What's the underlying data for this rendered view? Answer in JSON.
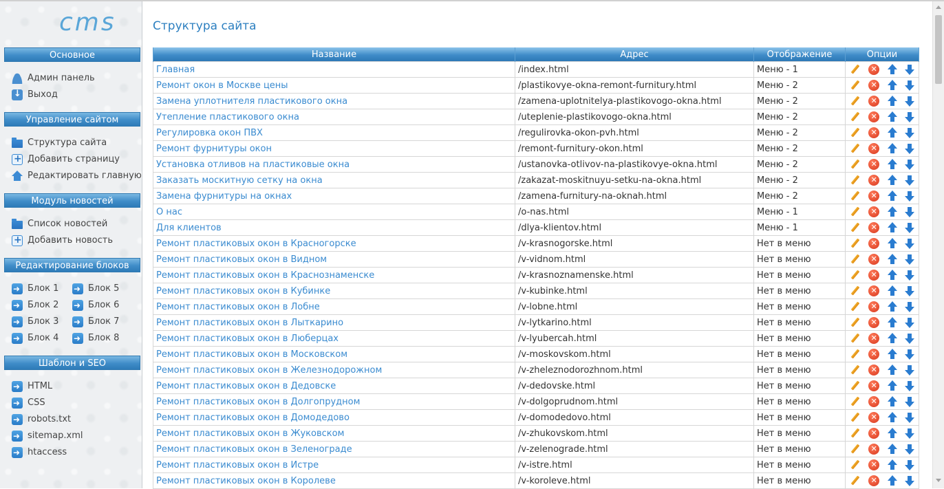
{
  "logo": "cms",
  "sidebar": {
    "sections": [
      {
        "title": "Основное",
        "items": [
          {
            "label": "Админ панель",
            "icon": "user-icon"
          },
          {
            "label": "Выход",
            "icon": "exit-icon"
          }
        ]
      },
      {
        "title": "Управление сайтом",
        "items": [
          {
            "label": "Структура сайта",
            "icon": "folder-icon"
          },
          {
            "label": "Добавить страницу",
            "icon": "add-icon"
          },
          {
            "label": "Редактировать главную",
            "icon": "home-icon"
          }
        ]
      },
      {
        "title": "Модуль новостей",
        "items": [
          {
            "label": "Список новостей",
            "icon": "folder-icon"
          },
          {
            "label": "Добавить новость",
            "icon": "add-icon"
          }
        ]
      },
      {
        "title": "Редактирование блоков",
        "items": [
          {
            "label": "Блок 1",
            "icon": "arrow-right-icon"
          },
          {
            "label": "Блок 5",
            "icon": "arrow-right-icon"
          },
          {
            "label": "Блок 2",
            "icon": "arrow-right-icon"
          },
          {
            "label": "Блок 6",
            "icon": "arrow-right-icon"
          },
          {
            "label": "Блок 3",
            "icon": "arrow-right-icon"
          },
          {
            "label": "Блок 7",
            "icon": "arrow-right-icon"
          },
          {
            "label": "Блок 4",
            "icon": "arrow-right-icon"
          },
          {
            "label": "Блок 8",
            "icon": "arrow-right-icon"
          }
        ]
      },
      {
        "title": "Шаблон и SEO",
        "items": [
          {
            "label": "HTML",
            "icon": "arrow-right-icon"
          },
          {
            "label": "CSS",
            "icon": "arrow-right-icon"
          },
          {
            "label": "robots.txt",
            "icon": "arrow-right-icon"
          },
          {
            "label": "sitemap.xml",
            "icon": "arrow-right-icon"
          },
          {
            "label": "htaccess",
            "icon": "arrow-right-icon"
          }
        ]
      }
    ]
  },
  "main": {
    "title": "Структура сайта",
    "table": {
      "columns": [
        "Название",
        "Адрес",
        "Отображение",
        "Опции"
      ],
      "rows": [
        [
          "Главная",
          "/index.html",
          "Меню - 1"
        ],
        [
          "Ремонт окон в Москве цены",
          "/plastikovye-okna-remont-furnitury.html",
          "Меню - 2"
        ],
        [
          "Замена уплотнителя пластикового окна",
          "/zamena-uplotnitelya-plastikovogo-okna.html",
          "Меню - 2"
        ],
        [
          "Утепление пластикового окна",
          "/uteplenie-plastikovogo-okna.html",
          "Меню - 2"
        ],
        [
          "Регулировка окон ПВХ",
          "/regulirovka-okon-pvh.html",
          "Меню - 2"
        ],
        [
          "Ремонт фурнитуры окон",
          "/remont-furnitury-okon.html",
          "Меню - 2"
        ],
        [
          "Установка отливов на пластиковые окна",
          "/ustanovka-otlivov-na-plastikovye-okna.html",
          "Меню - 2"
        ],
        [
          "Заказать москитную сетку на окна",
          "/zakazat-moskitnuyu-setku-na-okna.html",
          "Меню - 2"
        ],
        [
          "Замена фурнитуры на окнах",
          "/zamena-furnitury-na-oknah.html",
          "Меню - 2"
        ],
        [
          "О нас",
          "/o-nas.html",
          "Меню - 1"
        ],
        [
          "Для клиентов",
          "/dlya-klientov.html",
          "Меню - 1"
        ],
        [
          "Ремонт пластиковых окон в Красногорске",
          "/v-krasnogorske.html",
          "Нет в меню"
        ],
        [
          "Ремонт пластиковых окон в Видном",
          "/v-vidnom.html",
          "Нет в меню"
        ],
        [
          "Ремонт пластиковых окон в Краснознаменске",
          "/v-krasnoznamenske.html",
          "Нет в меню"
        ],
        [
          "Ремонт пластиковых окон в Кубинке",
          "/v-kubinke.html",
          "Нет в меню"
        ],
        [
          "Ремонт пластиковых окон в Лобне",
          "/v-lobne.html",
          "Нет в меню"
        ],
        [
          "Ремонт пластиковых окон в Лыткарино",
          "/v-lytkarino.html",
          "Нет в меню"
        ],
        [
          "Ремонт пластиковых окон в Люберцах",
          "/v-lyubercah.html",
          "Нет в меню"
        ],
        [
          "Ремонт пластиковых окон в Московском",
          "/v-moskovskom.html",
          "Нет в меню"
        ],
        [
          "Ремонт пластиковых окон в Железнодорожном",
          "/v-zheleznodorozhnom.html",
          "Нет в меню"
        ],
        [
          "Ремонт пластиковых окон в Дедовске",
          "/v-dedovske.html",
          "Нет в меню"
        ],
        [
          "Ремонт пластиковых окон в Долгопрудном",
          "/v-dolgoprudnom.html",
          "Нет в меню"
        ],
        [
          "Ремонт пластиковых окон в Домодедово",
          "/v-domodedovo.html",
          "Нет в меню"
        ],
        [
          "Ремонт пластиковых окон в Жуковском",
          "/v-zhukovskom.html",
          "Нет в меню"
        ],
        [
          "Ремонт пластиковых окон в Зеленограде",
          "/v-zelenograde.html",
          "Нет в меню"
        ],
        [
          "Ремонт пластиковых окон в Истре",
          "/v-istre.html",
          "Нет в меню"
        ],
        [
          "Ремонт пластиковых окон в Королеве",
          "/v-koroleve.html",
          "Нет в меню"
        ]
      ],
      "option_icons": [
        "edit-icon",
        "delete-icon",
        "move-up-icon",
        "move-down-icon"
      ]
    }
  },
  "colors": {
    "accent": "#3a8bd0",
    "header_bar": "#3f8cc8",
    "delete": "#d8361c",
    "edit": "#f2b233"
  }
}
